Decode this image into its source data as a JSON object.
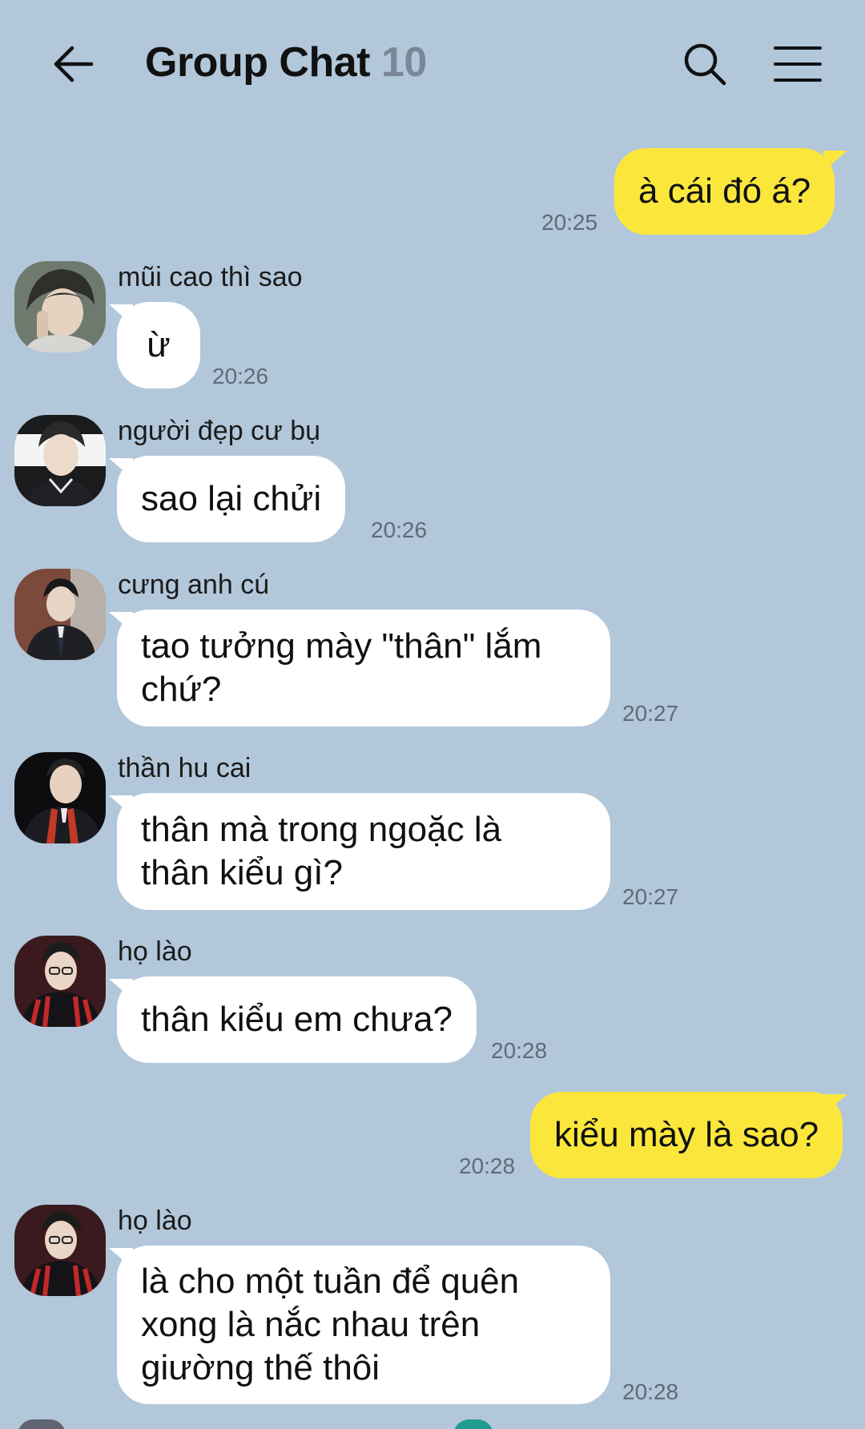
{
  "header": {
    "title": "Group Chat",
    "member_count": "10",
    "back_icon": "arrow-left-icon",
    "search_icon": "search-icon",
    "menu_icon": "hamburger-menu-icon"
  },
  "colors": {
    "background": "#b2c7da",
    "incoming_bubble": "#ffffff",
    "outgoing_bubble": "#fbe73c",
    "timestamp": "#5f6b78"
  },
  "messages": [
    {
      "direction": "out",
      "text": "à cái đó á?",
      "time": "20:25"
    },
    {
      "direction": "in",
      "sender": "mũi cao thì sao",
      "text": "ừ",
      "time": "20:26"
    },
    {
      "direction": "in",
      "sender": "người đẹp cư bụ",
      "text": "sao lại chửi",
      "time": "20:26"
    },
    {
      "direction": "in",
      "sender": "cưng anh cú",
      "text": "tao tưởng mày \"thân\" lắm\nchứ?",
      "time": "20:27"
    },
    {
      "direction": "in",
      "sender": "thần hu cai",
      "text": "thân mà trong ngoặc là\nthân kiểu gì?",
      "time": "20:27"
    },
    {
      "direction": "in",
      "sender": "họ lào",
      "text": "thân kiểu em chưa?",
      "time": "20:28"
    },
    {
      "direction": "out",
      "text": "kiểu mày là sao?",
      "time": "20:28"
    },
    {
      "direction": "in",
      "sender": "họ lào",
      "text": "là cho một tuần để quên\nxong là nắc nhau trên\ngiường thế thôi",
      "time": "20:28"
    }
  ]
}
